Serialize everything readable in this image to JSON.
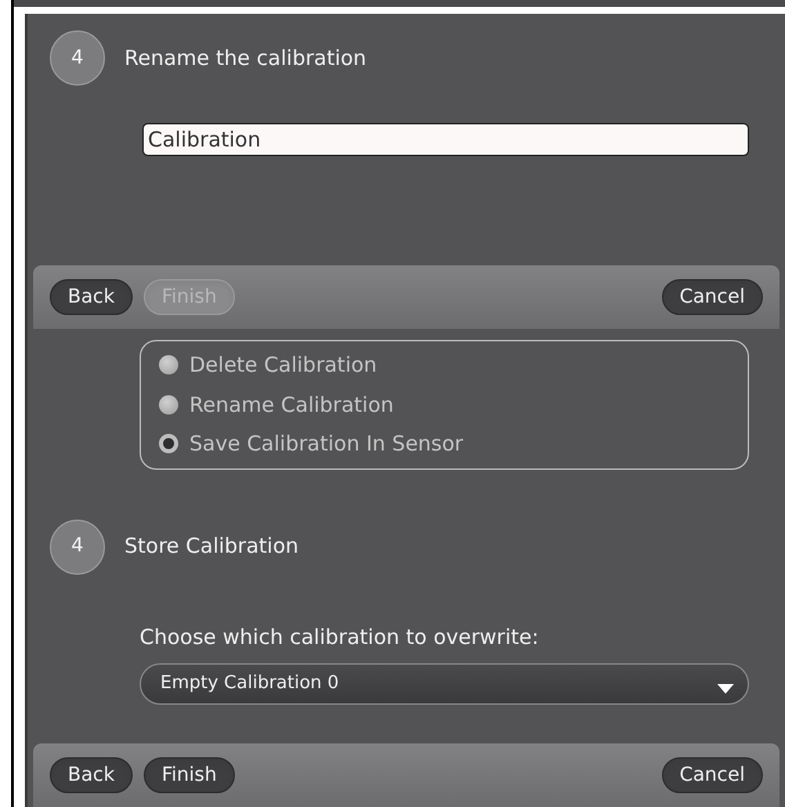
{
  "rename_step": {
    "step": "4",
    "title": "Rename the calibration",
    "name_field": {
      "value": "Calibration"
    },
    "buttons": [
      {
        "label": "Back",
        "disabled": false
      },
      {
        "label": "Finish",
        "disabled": true
      },
      {
        "label": "Cancel",
        "disabled": false
      }
    ]
  },
  "store_step": {
    "options": [
      {
        "label": "Delete Calibration",
        "selected": false
      },
      {
        "label": "Rename Calibration",
        "selected": false
      },
      {
        "label": "Save Calibration In Sensor",
        "selected": true
      }
    ],
    "step": "4",
    "title": "Store Calibration",
    "prompt": "Choose which calibration to overwrite:",
    "dropdown": {
      "value": "Empty Calibration 0"
    },
    "buttons": [
      {
        "label": "Back",
        "disabled": false
      },
      {
        "label": "Finish",
        "disabled": false
      },
      {
        "label": "Cancel",
        "disabled": false
      }
    ]
  }
}
